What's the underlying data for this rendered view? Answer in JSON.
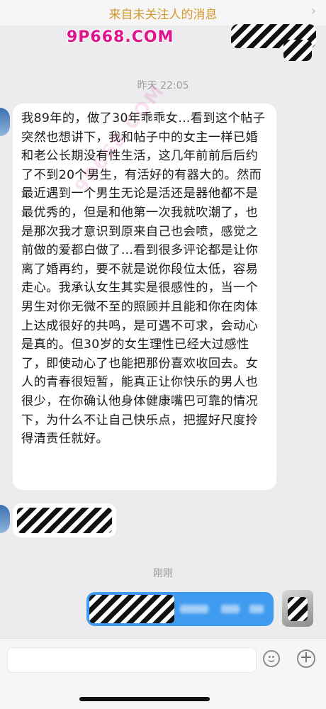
{
  "header": {
    "title": "来自未关注人的消息",
    "chevron_icon": "chevron-right-icon"
  },
  "watermark": {
    "logo_text": "9P668.COM",
    "diagonal_text": "9P668.COM",
    "color": "#e0128c"
  },
  "messages": [
    {
      "type": "timestamp",
      "text": "昨天 22:05"
    },
    {
      "type": "incoming",
      "text": "我89年的，做了30年乖乖女…看到这个帖子突然也想讲下，我和帖子中的女主一样已婚和老公长期没有性生活，这几年前前后后约了不到20个男生，有活好的有器大的。然而最近遇到一个男生无论是活还是器他都不是最优秀的，但是和他第一次我就吹潮了，也是那次我才意识到原来自己也会喷，感觉之前做的爱都白做了…看到很多评论都是让你离了婚再约，要不就是说你段位太低，容易走心。我承认女生其实是很感性的，当一个男生对你无微不至的照顾并且能和你在肉体上达成很好的共鸣，是可遇不可求，会动心是真的。但30岁的女生理性已经大过感性了，即使动心了也能把那份喜欢收回去。女人的青春很短暂，能真正让你快乐的男人也很少，在你确认他身体健康嘴巴可靠的情况下，为什么不让自己快乐点，把握好尺度拎得清责任就好。"
    },
    {
      "type": "incoming",
      "redacted": true
    },
    {
      "type": "timestamp",
      "text": "刚刚"
    },
    {
      "type": "outgoing",
      "redacted": true
    }
  ],
  "input_bar": {
    "emoji_icon": "emoji-icon",
    "plus_icon": "plus-icon",
    "plus_glyph": "+"
  },
  "colors": {
    "header_text": "#d39a2e",
    "outgoing_bubble": "#3f9bf0",
    "incoming_bubble": "#ffffff",
    "background": "#ececee"
  }
}
